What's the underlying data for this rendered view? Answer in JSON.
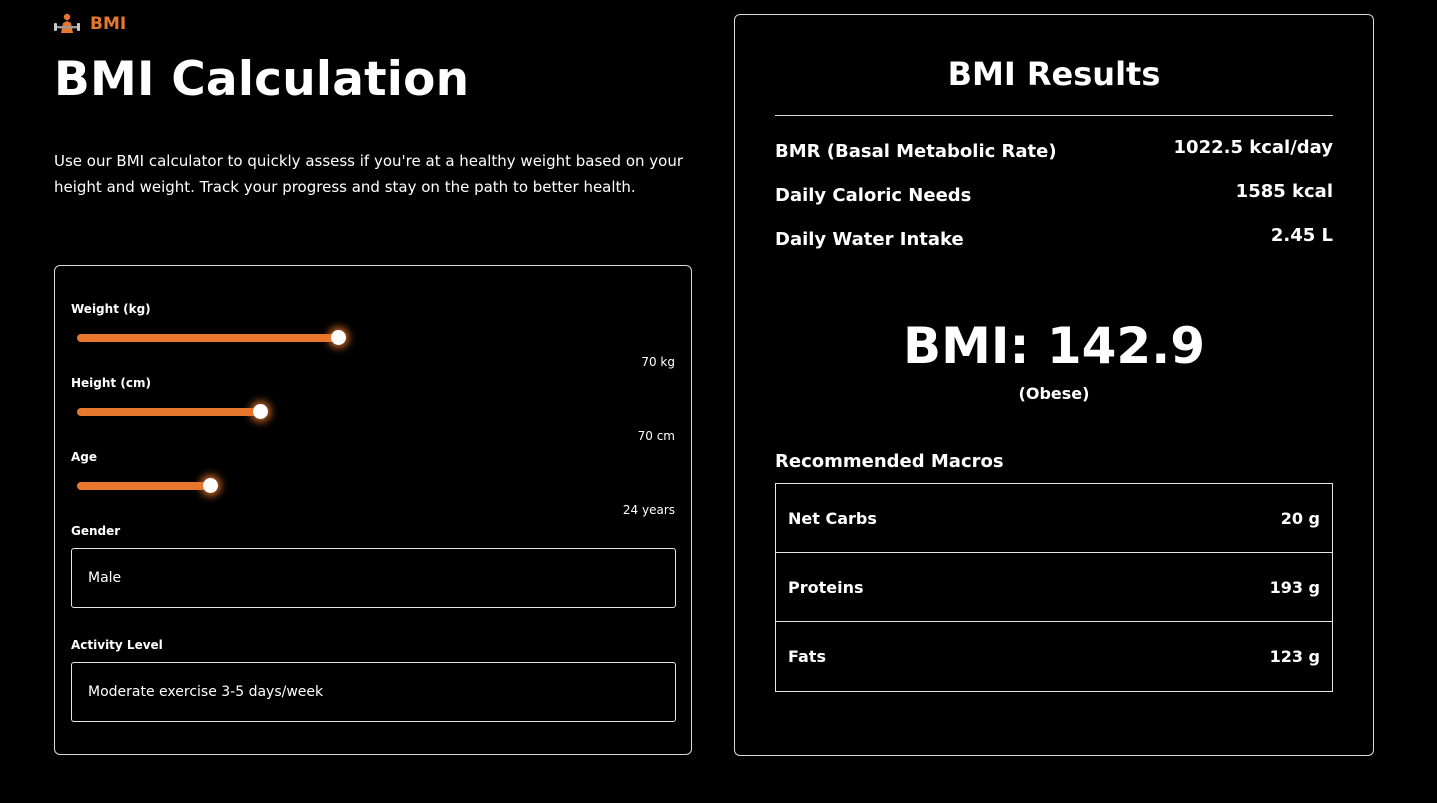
{
  "brand": {
    "name": "BMI",
    "icon": "weightlifter-icon",
    "color": "#e8772e"
  },
  "page": {
    "title": "BMI Calculation",
    "intro": "Use our BMI calculator to quickly assess if you're at a healthy weight based on your height and weight. Track your progress and stay on the path to better health."
  },
  "form": {
    "weight": {
      "label": "Weight (kg)",
      "display": "70 kg",
      "fill": 0.5
    },
    "height": {
      "label": "Height (cm)",
      "display": "70 cm",
      "fill": 0.35
    },
    "age": {
      "label": "Age",
      "display": "24 years",
      "fill": 0.25
    },
    "gender": {
      "label": "Gender",
      "value": "Male"
    },
    "activity": {
      "label": "Activity Level",
      "value": "Moderate exercise 3-5 days/week"
    }
  },
  "results": {
    "title": "BMI Results",
    "stats": [
      {
        "label": "BMR (Basal Metabolic Rate)",
        "value": "1022.5 kcal/day"
      },
      {
        "label": "Daily Caloric Needs",
        "value": "1585 kcal"
      },
      {
        "label": "Daily Water Intake",
        "value": "2.45 L"
      }
    ],
    "bmi": "BMI: 142.9",
    "category": "(Obese)",
    "macros_title": "Recommended Macros",
    "macros": [
      {
        "label": "Net Carbs",
        "value": "20 g"
      },
      {
        "label": "Proteins",
        "value": "193 g"
      },
      {
        "label": "Fats",
        "value": "123 g"
      }
    ]
  },
  "colors": {
    "accent": "#e8772e",
    "background": "#000000",
    "border": "#d9d9d9"
  }
}
